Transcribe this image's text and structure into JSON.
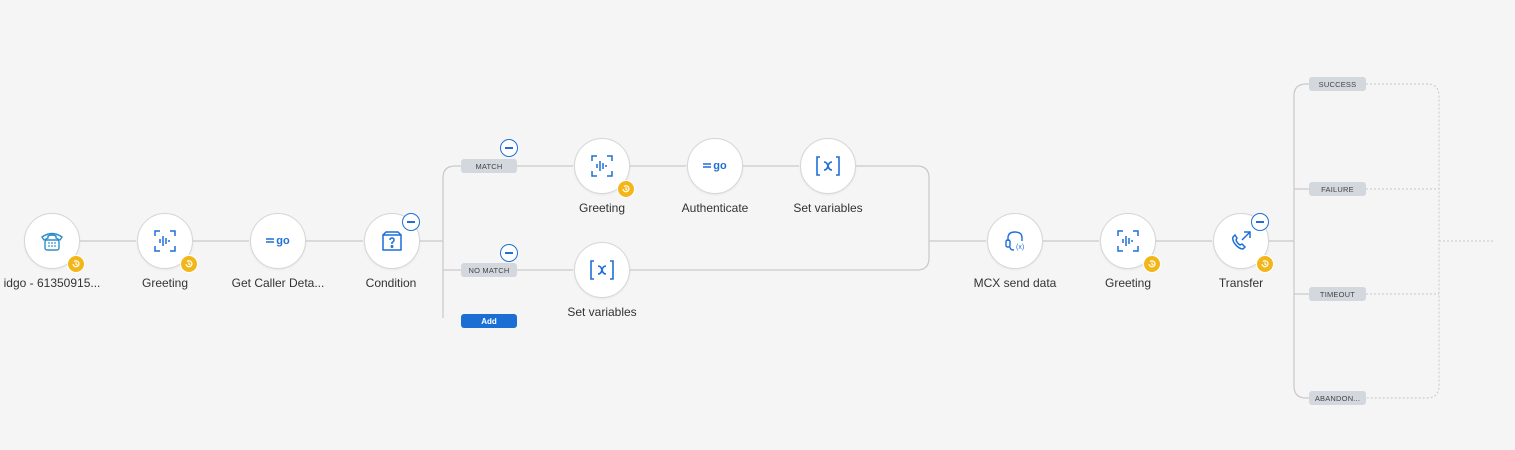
{
  "nodes": {
    "entry": {
      "label": "idgo - 61350915...",
      "icon": "phone-icon"
    },
    "greeting1": {
      "label": "Greeting",
      "icon": "audio-waveform-icon"
    },
    "get_caller": {
      "label": "Get Caller Deta...",
      "icon": "idgo-logo-icon"
    },
    "condition": {
      "label": "Condition",
      "icon": "question-box-icon"
    },
    "greeting_match": {
      "label": "Greeting",
      "icon": "audio-waveform-icon"
    },
    "authenticate": {
      "label": "Authenticate",
      "icon": "idgo-logo-icon"
    },
    "set_vars_match": {
      "label": "Set variables",
      "icon": "variable-x-icon"
    },
    "set_vars_nomatch": {
      "label": "Set variables",
      "icon": "variable-x-icon"
    },
    "mcx_send": {
      "label": "MCX send data",
      "icon": "headset-variable-icon"
    },
    "greeting2": {
      "label": "Greeting",
      "icon": "audio-waveform-icon"
    },
    "transfer": {
      "label": "Transfer",
      "icon": "phone-transfer-icon"
    }
  },
  "branches": {
    "match": "MATCH",
    "no_match": "NO MATCH",
    "add": "Add"
  },
  "outcomes": [
    "SUCCESS",
    "FAILURE",
    "TIMEOUT",
    "ABANDON..."
  ],
  "logo_text": "go",
  "colors": {
    "canvas": "#f5f5f5",
    "accent": "#1f6fd6",
    "badge": "#f2b619",
    "connector": "#c9c9c9",
    "tag": "#d3d7de",
    "add_button": "#1b6fd4"
  }
}
